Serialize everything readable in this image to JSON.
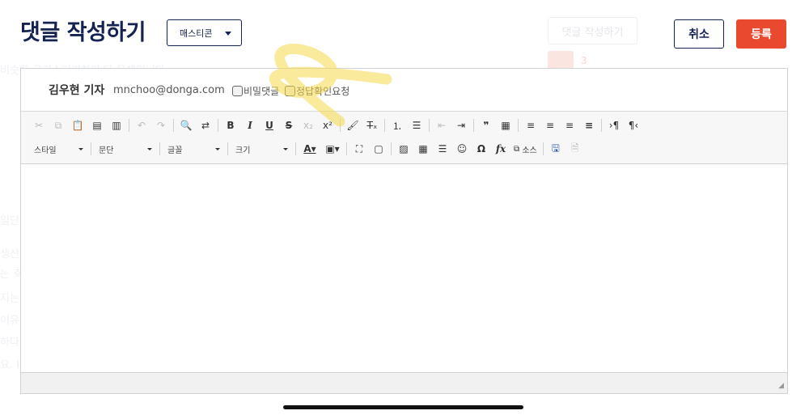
{
  "header": {
    "title": "댓글 작성하기",
    "emoticon_select": "매스티콘",
    "cancel_label": "취소",
    "submit_label": "등록"
  },
  "background": {
    "button_label": "댓글 작성하기",
    "like_count": "3",
    "line1": "비슷한 구기스리키한의 다 문제입니다",
    "frag1": "일단",
    "frag2": "생산",
    "frag3": "는 축",
    "frag4": "지는",
    "frag5": "이유",
    "frag6": "하다",
    "frag7": "요. I"
  },
  "author": {
    "name": "김우현 기자",
    "email": "mnchoo@donga.com",
    "secret_label": "비밀댓글",
    "answer_label": "정답확인요청"
  },
  "toolbar": {
    "style_label": "스타일",
    "paragraph_label": "문단",
    "font_label": "글꼴",
    "size_label": "크기",
    "source_label": "소스"
  },
  "accent": {
    "navy": "#152353",
    "submit_red": "#e8492f",
    "highlight_yellow": "#f5d84a"
  }
}
